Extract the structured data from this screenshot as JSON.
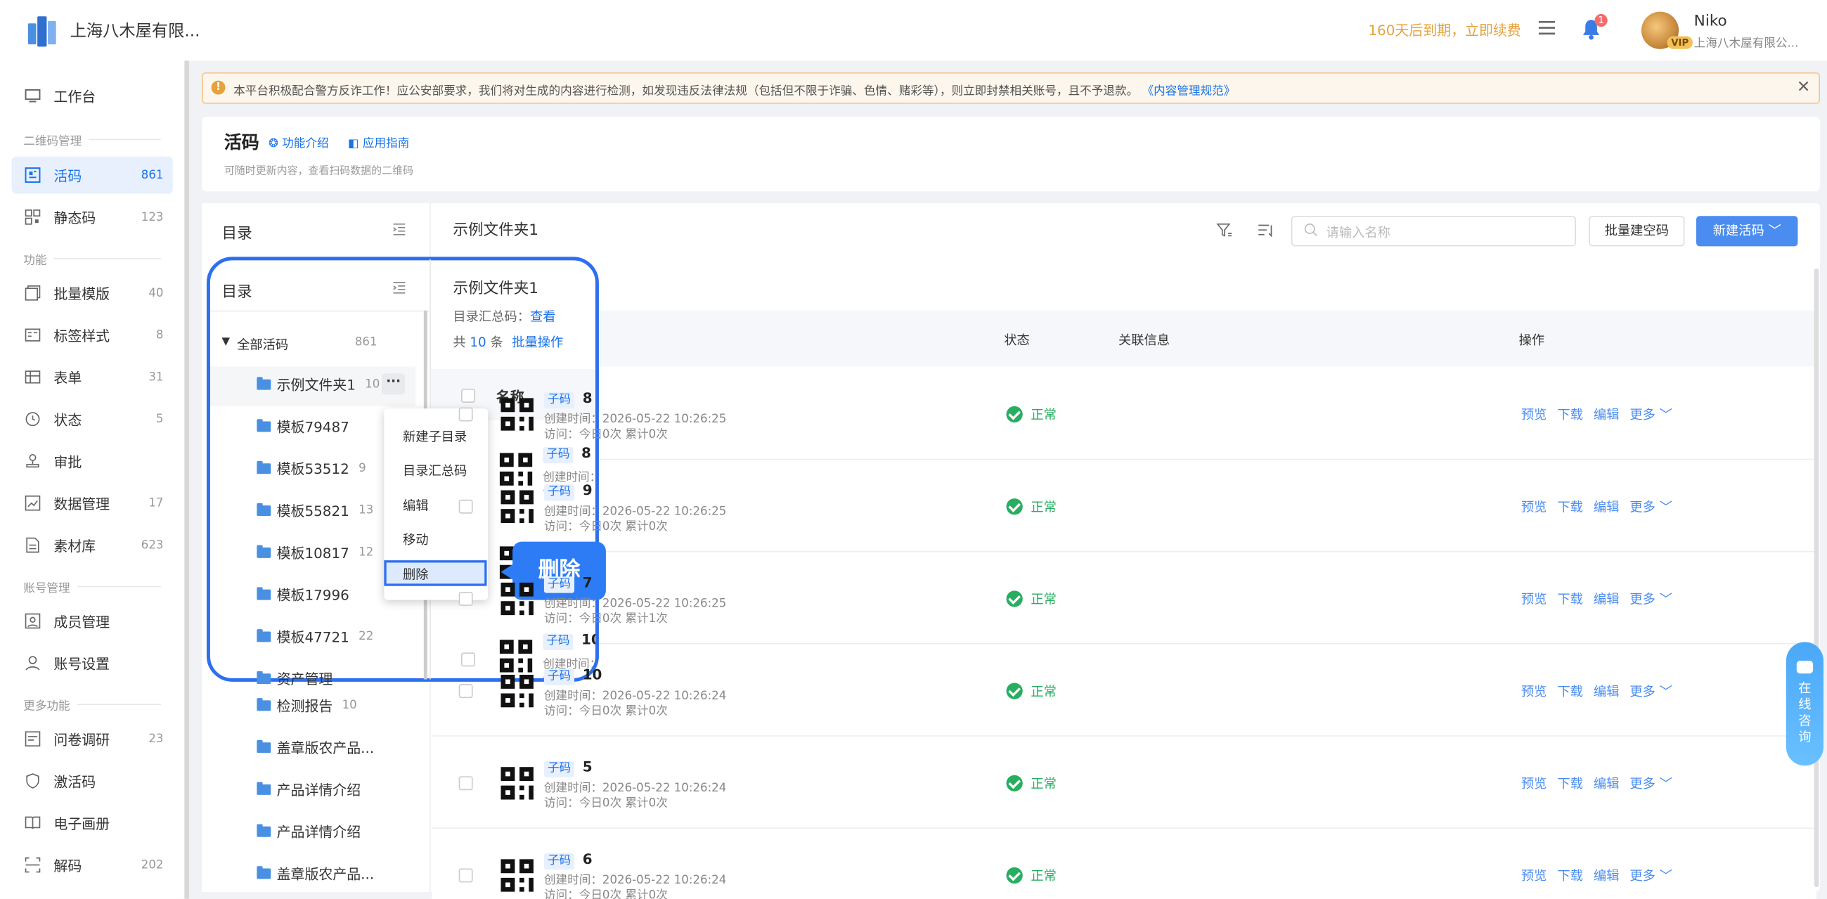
{
  "topbar": {
    "company": "上海八木屋有限...",
    "expire": "160天后到期，立即续费",
    "notif_count": "1",
    "user_name": "Niko",
    "user_company": "上海八木屋有限公...",
    "vip": "VIP"
  },
  "sidebar": {
    "workbench": "工作台",
    "group1": "二维码管理",
    "huoma": "活码",
    "huoma_count": "861",
    "static": "静态码",
    "static_count": "123",
    "group2": "功能",
    "batch": "批量模版",
    "batch_count": "40",
    "label": "标签样式",
    "label_count": "8",
    "form": "表单",
    "form_count": "31",
    "state": "状态",
    "state_count": "5",
    "audit": "审批",
    "data": "数据管理",
    "data_count": "17",
    "material": "素材库",
    "material_count": "623",
    "group3": "账号管理",
    "members": "成员管理",
    "account": "账号设置",
    "group4": "更多功能",
    "survey": "问卷调研",
    "survey_count": "23",
    "activate": "激活码",
    "album": "电子画册",
    "decode": "解码",
    "decode_count": "202"
  },
  "notice": {
    "text": "本平台积极配合警方反诈工作！应公安部要求，我们将对生成的内容进行检测，如发现违反法律法规（包括但不限于诈骗、色情、赌彩等），则立即封禁相关账号，且不予退款。",
    "link": "《内容管理规范》"
  },
  "header": {
    "title": "活码",
    "link1": "功能介绍",
    "link2": "应用指南",
    "subtitle": "可随时更新内容，查看扫码数据的二维码"
  },
  "directory": {
    "title": "目录",
    "root": "全部活码",
    "root_count": "861",
    "items": [
      {
        "name": "示例文件夹1",
        "count": "10"
      },
      {
        "name": "模板79487",
        "count": ""
      },
      {
        "name": "模板53512",
        "count": "9"
      },
      {
        "name": "模板55821",
        "count": "13"
      },
      {
        "name": "模板10817",
        "count": "12"
      },
      {
        "name": "模板17996",
        "count": ""
      },
      {
        "name": "模板47721",
        "count": "22"
      },
      {
        "name": "资产管理",
        "count": ""
      },
      {
        "name": "检测报告",
        "count": "10"
      },
      {
        "name": "盖章版农产品...",
        "count": ""
      },
      {
        "name": "产品详情介绍",
        "count": ""
      },
      {
        "name": "产品详情介绍",
        "count": ""
      },
      {
        "name": "盖章版农产品...",
        "count": ""
      }
    ]
  },
  "main": {
    "folder": "示例文件夹1",
    "summary_label": "目录汇总码：",
    "summary_link": "查看",
    "total_prefix": "共",
    "total_count": "10",
    "total_suffix": "条",
    "batch_ops": "批量操作",
    "search_placeholder": "请输入名称",
    "batch_blank": "批量建空码",
    "new_btn": "新建活码 ﹀"
  },
  "table": {
    "headers": {
      "name": "名称",
      "status": "状态",
      "related": "关联信息",
      "ops": "操作"
    },
    "tag": "子码",
    "created_label": "创建时间：",
    "visits_label": "访问：",
    "rows": [
      {
        "name": "8",
        "created": "2026-05-22 10:26:25",
        "visits": "今日0次 累计0次",
        "status": "正常"
      },
      {
        "name": "9",
        "created": "2026-05-22 10:26:25",
        "visits": "今日0次 累计0次",
        "status": "正常"
      },
      {
        "name": "7",
        "created": "2026-05-22 10:26:25",
        "visits": "今日0次 累计1次",
        "status": "正常"
      },
      {
        "name": "10",
        "created": "2026-05-22 10:26:24",
        "visits": "今日0次 累计0次",
        "status": "正常"
      },
      {
        "name": "5",
        "created": "2026-05-22 10:26:24",
        "visits": "今日0次 累计0次",
        "status": "正常"
      },
      {
        "name": "6",
        "created": "2026-05-22 10:26:24",
        "visits": "今日0次 累计0次",
        "status": "正常"
      }
    ],
    "ops": {
      "preview": "预览",
      "download": "下载",
      "edit": "编辑",
      "more": "更多 ﹀"
    }
  },
  "context_menu": {
    "new_sub": "新建子目录",
    "summary": "目录汇总码",
    "edit": "编辑",
    "move": "移动",
    "delete": "删除"
  },
  "callout": "删除",
  "float_help": "在线咨询"
}
